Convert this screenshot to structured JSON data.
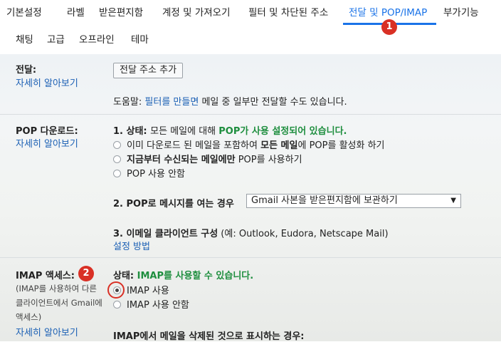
{
  "tabs": {
    "items": [
      {
        "label": "기본설정"
      },
      {
        "label": "라벨"
      },
      {
        "label": "받은편지함"
      },
      {
        "label": "계정 및 가져오기"
      },
      {
        "label": "필터 및 차단된 주소"
      },
      {
        "label": "전달 및 POP/IMAP"
      },
      {
        "label": "부가기능"
      },
      {
        "label": "채팅"
      },
      {
        "label": "고급"
      },
      {
        "label": "오프라인"
      },
      {
        "label": "테마"
      }
    ],
    "active_badge": "1"
  },
  "forwarding": {
    "label": "전달:",
    "learn_more": "자세히 알아보기",
    "add_button": "전달 주소 추가",
    "tip_prefix": "도움말: ",
    "tip_link": "필터를 만들면",
    "tip_suffix": " 메일 중 일부만 전달할 수도 있습니다."
  },
  "pop": {
    "label": "POP 다운로드:",
    "learn_more": "자세히 알아보기",
    "status_label": "1. 상태: ",
    "status_text": "모든 메일에 대해 ",
    "status_value": "POP가 사용 설정되어 있습니다.",
    "options": [
      {
        "pre": "이미 다운로드 된 메일을 포함하여 ",
        "bold": "모든 메일",
        "post": "에 POP를 활성화 하기"
      },
      {
        "pre": "",
        "bold": "지금부터 수신되는 메일에만",
        "post": " POP를 사용하기"
      },
      {
        "pre": "POP 사용 안함",
        "bold": "",
        "post": ""
      }
    ],
    "when_accessed_label": "2. POP로 메시지를 여는 경우",
    "when_accessed_value": "Gmail 사본을 받은편지함에 보관하기",
    "configure_label": "3. 이메일 클라이언트 구성",
    "configure_examples": " (예: Outlook, Eudora, Netscape Mail)",
    "configure_link": "설정 방법"
  },
  "imap": {
    "label": "IMAP 액세스:",
    "badge": "2",
    "description_line1": "(IMAP를 사용하여 다른",
    "description_line2": "클라이언트에서 Gmail에",
    "description_line3": "액세스)",
    "learn_more": "자세히 알아보기",
    "status_label": "상태: ",
    "status_value": "IMAP를 사용할 수 있습니다.",
    "options": [
      {
        "label": "IMAP 사용",
        "checked": true
      },
      {
        "label": "IMAP 사용 안함",
        "checked": false
      }
    ],
    "delete_label": "IMAP에서 메일을 삭제된 것으로 표시하는 경우:"
  }
}
